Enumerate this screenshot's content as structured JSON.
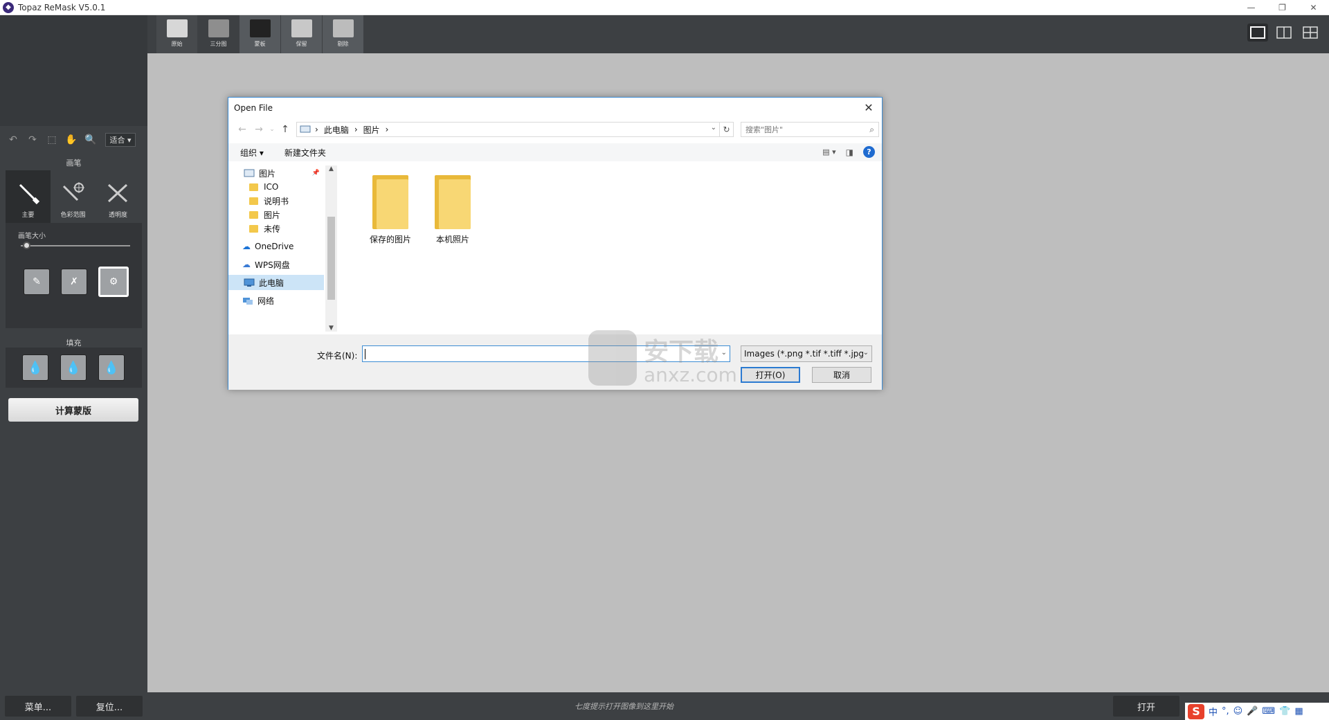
{
  "app": {
    "title": "Topaz ReMask V5.0.1",
    "window_controls": [
      "—",
      "❐",
      "✕"
    ]
  },
  "toolbar": {
    "view_tabs": [
      {
        "label": "原始"
      },
      {
        "label": "三分图"
      },
      {
        "label": "蒙板"
      },
      {
        "label": "保留"
      },
      {
        "label": "剔除"
      }
    ]
  },
  "left_panel": {
    "zoom_value": "适合",
    "brush_section_label": "画笔",
    "brushes": [
      {
        "label": "主要"
      },
      {
        "label": "色彩范围"
      },
      {
        "label": "透明度"
      }
    ],
    "brush_size_label": "画笔大小",
    "brush_size_value": 0.05,
    "fill_section_label": "填充",
    "compute_button": "计算蒙版"
  },
  "bottom_bar": {
    "menu_button": "菜单...",
    "reset_button": "复位...",
    "hint": "七度提示打开图像到这里开始",
    "open_button": "打开",
    "ime_chars": [
      "中",
      "°,",
      "☺",
      "🎤",
      "⌨",
      "👕",
      "▦"
    ]
  },
  "dialog": {
    "title": "Open File",
    "address": {
      "crumbs": [
        "此电脑",
        "图片"
      ]
    },
    "search_placeholder": "搜索\"图片\"",
    "commands": {
      "organize": "组织 ▾",
      "new_folder": "新建文件夹"
    },
    "tree": [
      {
        "label": "图片",
        "type": "pictures",
        "pinned": true
      },
      {
        "label": "ICO",
        "type": "folder"
      },
      {
        "label": "说明书",
        "type": "folder"
      },
      {
        "label": "图片",
        "type": "folder"
      },
      {
        "label": "未传",
        "type": "folder"
      },
      {
        "label": "OneDrive",
        "type": "cloud"
      },
      {
        "label": "WPS网盘",
        "type": "cloud"
      },
      {
        "label": "此电脑",
        "type": "pc",
        "selected": true
      },
      {
        "label": "网络",
        "type": "network"
      }
    ],
    "files": [
      {
        "name": "保存的图片"
      },
      {
        "name": "本机照片"
      }
    ],
    "filename_label": "文件名(N):",
    "filename_value": "",
    "file_type": "Images (*.png *.tif *.tiff *.jpg",
    "open_button": "打开(O)",
    "cancel_button": "取消"
  },
  "watermark": {
    "text": "安下载",
    "sub": "anxz.com"
  },
  "colors": {
    "panel": "#3d4043",
    "canvas": "#bebebe",
    "dialog_border": "#3b8bd3",
    "folder": "#f8d774"
  }
}
